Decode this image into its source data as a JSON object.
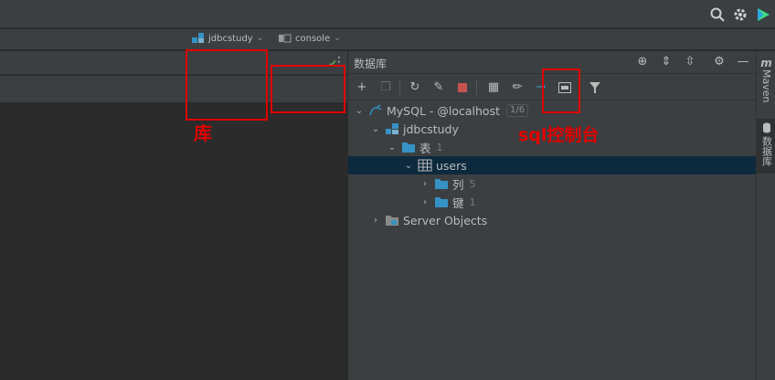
{
  "window": {
    "search_icon": "search-icon",
    "settings_icon": "gear-icon",
    "plugin_icon": "plugin-icon"
  },
  "editor": {
    "database_selector": "jdbcstudy",
    "console_selector": "console"
  },
  "db_panel": {
    "title": "数据库",
    "toolbar": [
      "add",
      "copy",
      "refresh",
      "edit-schema",
      "stop",
      "table-view",
      "edit",
      "jump",
      "query-console",
      "filter"
    ],
    "tree": {
      "datasource": {
        "name": "MySQL - @localhost",
        "badge": "1/6"
      },
      "schema": {
        "name": "jdbcstudy"
      },
      "tables_folder": {
        "name": "表",
        "count": "1"
      },
      "table": {
        "name": "users"
      },
      "columns_folder": {
        "name": "列",
        "count": "5"
      },
      "keys_folder": {
        "name": "键",
        "count": "1"
      },
      "server_objects": {
        "name": "Server Objects"
      }
    }
  },
  "right_strip": {
    "maven_letter": "m",
    "maven_label": "Maven",
    "db_label": "数据库"
  },
  "annotations": {
    "library_label": "库",
    "sql_console_label": "sql控制台"
  },
  "colors": {
    "annotation_red": "#e00000",
    "selection_bg": "#0d293e",
    "panel_bg": "#3c3f41",
    "editor_bg": "#2b2b2b",
    "folder_blue": "#3592c4"
  }
}
